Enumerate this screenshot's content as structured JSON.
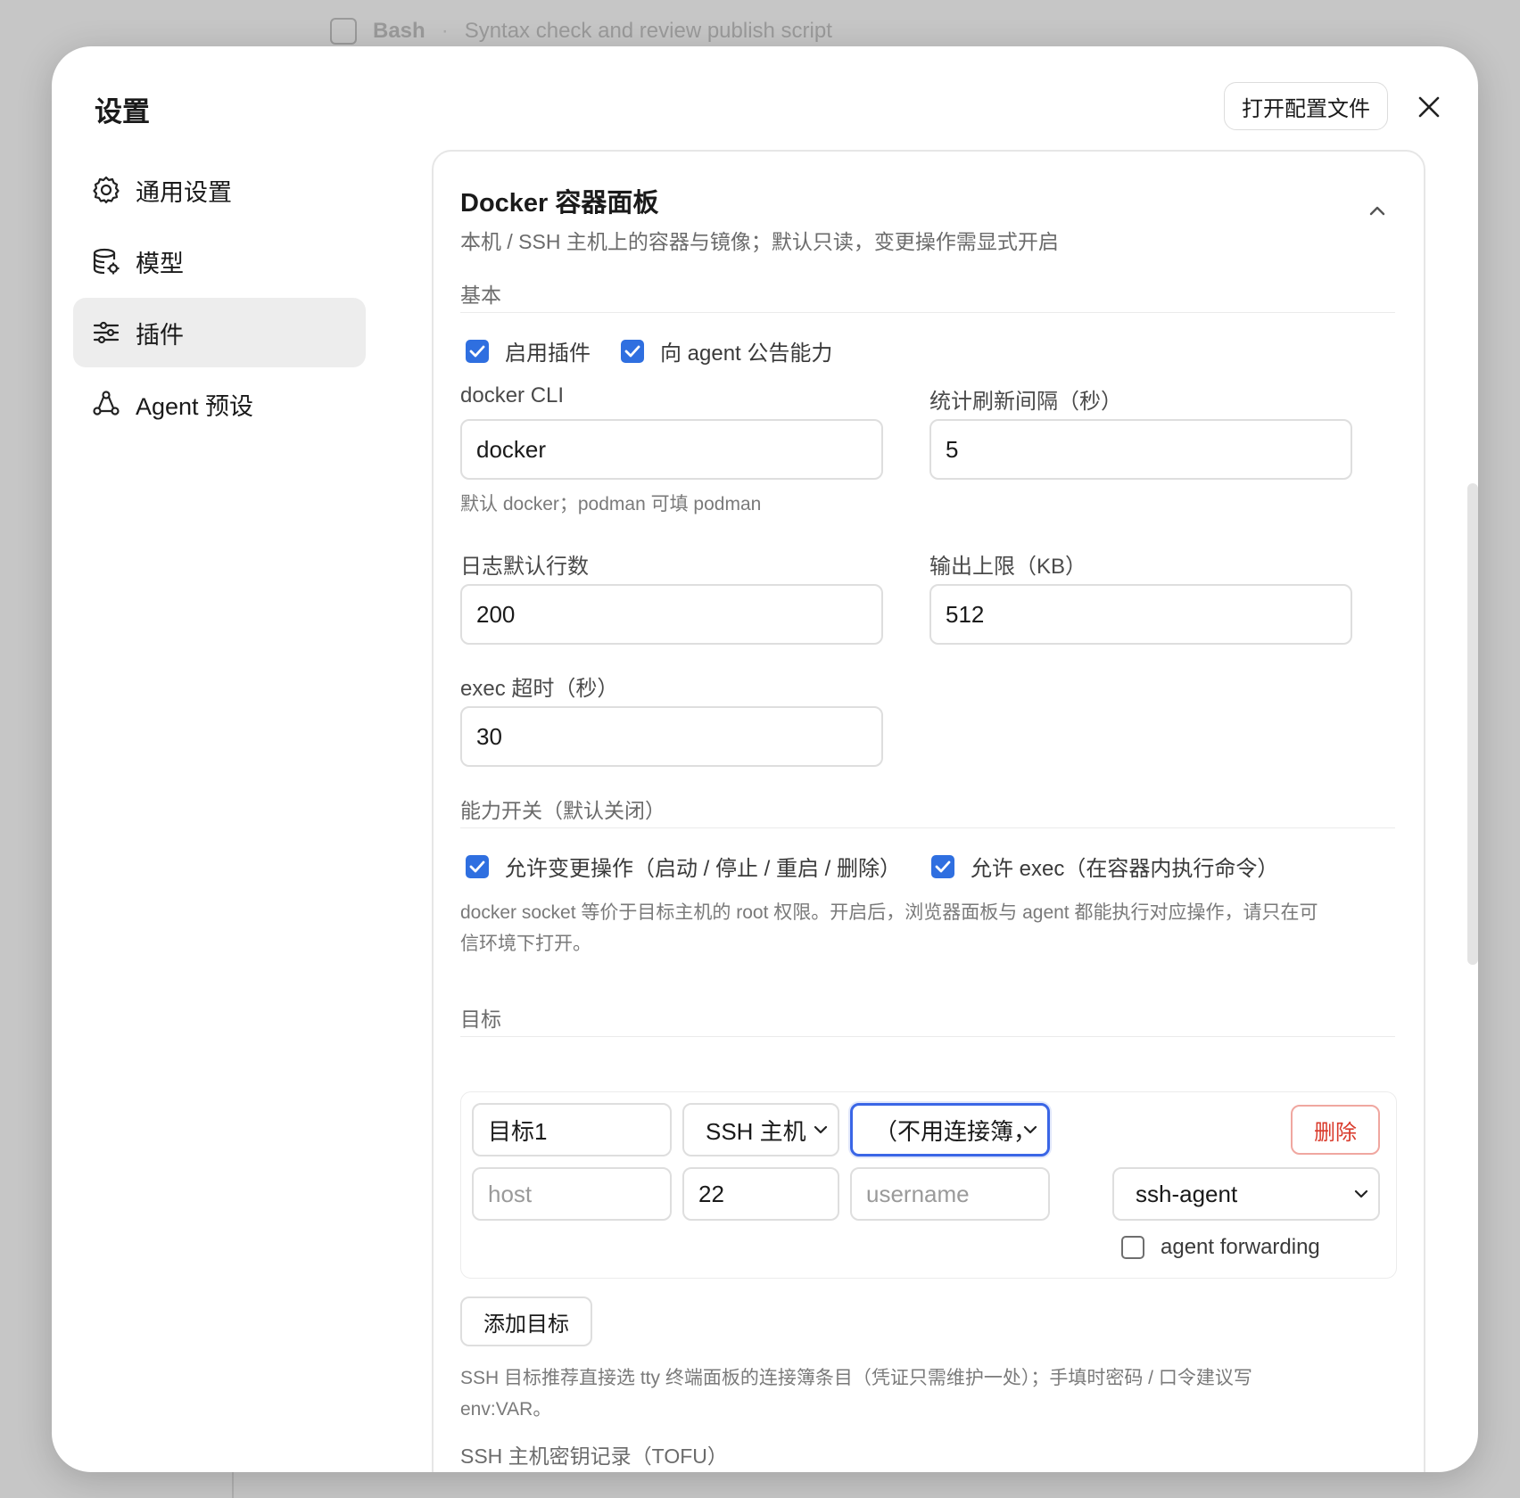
{
  "background": {
    "tool_name": "Bash",
    "task_text": "Syntax check and review publish script"
  },
  "modal": {
    "title": "设置",
    "open_config_label": "打开配置文件"
  },
  "sidebar": {
    "items": [
      {
        "label": "通用设置",
        "icon": "gear-icon",
        "active": false
      },
      {
        "label": "模型",
        "icon": "database-icon",
        "active": false
      },
      {
        "label": "插件",
        "icon": "sliders-icon",
        "active": true
      },
      {
        "label": "Agent 预设",
        "icon": "agent-icon",
        "active": false
      }
    ]
  },
  "plugin": {
    "title": "Docker 容器面板",
    "subtitle": "本机 / SSH 主机上的容器与镜像；默认只读，变更操作需显式开启",
    "basic": {
      "heading": "基本",
      "enable_label": "启用插件",
      "enable_checked": true,
      "announce_label": "向 agent 公告能力",
      "announce_checked": true,
      "cli_label": "docker CLI",
      "cli_value": "docker",
      "cli_help": "默认 docker；podman 可填 podman",
      "refresh_label": "统计刷新间隔（秒）",
      "refresh_value": "5",
      "log_lines_label": "日志默认行数",
      "log_lines_value": "200",
      "output_limit_label": "输出上限（KB）",
      "output_limit_value": "512",
      "exec_timeout_label": "exec 超时（秒）",
      "exec_timeout_value": "30"
    },
    "capabilities": {
      "heading": "能力开关（默认关闭）",
      "mutate_label": "允许变更操作（启动 / 停止 / 重启 / 删除）",
      "mutate_checked": true,
      "exec_label": "允许 exec（在容器内执行命令）",
      "exec_checked": true,
      "warning_line1": "docker socket 等价于目标主机的 root 权限。开启后，浏览器面板与 agent 都能执行对应操作，请只在可",
      "warning_line2": "信环境下打开。"
    },
    "targets": {
      "heading": "目标",
      "items": [
        {
          "name": "目标1",
          "type": "SSH 主机",
          "connection": "（不用连接簿，",
          "host_placeholder": "host",
          "port": "22",
          "username_placeholder": "username",
          "auth": "ssh-agent",
          "agent_forwarding_label": "agent forwarding",
          "agent_forwarding_checked": false,
          "delete_label": "删除"
        }
      ],
      "add_label": "添加目标",
      "help_line1": "SSH 目标推荐直接选 tty 终端面板的连接簿条目（凭证只需维护一处）；手填时密码 / 口令建议写",
      "help_line2": "env:VAR。"
    },
    "tofu_heading": "SSH 主机密钥记录（TOFU）"
  },
  "colors": {
    "accent": "#2f6fe0",
    "focus": "#3a66e6",
    "danger": "#d93a2b"
  }
}
